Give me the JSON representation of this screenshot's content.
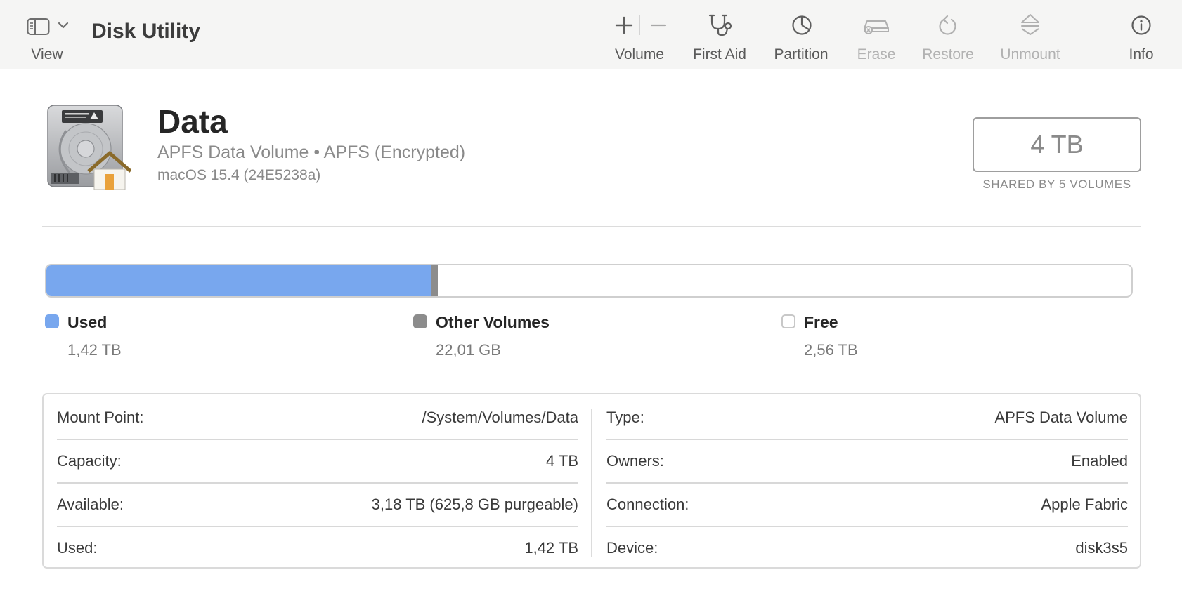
{
  "toolbar": {
    "view_label": "View",
    "app_title": "Disk Utility",
    "volume_label": "Volume",
    "first_aid_label": "First Aid",
    "partition_label": "Partition",
    "erase_label": "Erase",
    "restore_label": "Restore",
    "unmount_label": "Unmount",
    "info_label": "Info"
  },
  "volume": {
    "name": "Data",
    "type_line": "APFS Data Volume • APFS (Encrypted)",
    "os_line": "macOS 15.4 (24E5238a)",
    "capacity": "4 TB",
    "shared_label": "SHARED BY 5 VOLUMES"
  },
  "usage": {
    "used_fraction": 0.355,
    "other_fraction": 0.0055,
    "colors": {
      "used": "#78a7ee",
      "other": "#8c8c8c",
      "free": "#ffffff"
    },
    "legend": [
      {
        "name": "Used",
        "value": "1,42 TB"
      },
      {
        "name": "Other Volumes",
        "value": "22,01 GB"
      },
      {
        "name": "Free",
        "value": "2,56 TB"
      }
    ]
  },
  "info": {
    "left": [
      {
        "key": "Mount Point:",
        "value": "/System/Volumes/Data"
      },
      {
        "key": "Capacity:",
        "value": "4 TB"
      },
      {
        "key": "Available:",
        "value": "3,18 TB (625,8 GB purgeable)"
      },
      {
        "key": "Used:",
        "value": "1,42 TB"
      }
    ],
    "right": [
      {
        "key": "Type:",
        "value": "APFS Data Volume"
      },
      {
        "key": "Owners:",
        "value": "Enabled"
      },
      {
        "key": "Connection:",
        "value": "Apple Fabric"
      },
      {
        "key": "Device:",
        "value": "disk3s5"
      }
    ]
  },
  "icons": {
    "sidebar": "sidebar-icon",
    "chevron": "chevron-down-icon",
    "add": "plus-icon",
    "remove": "minus-icon",
    "first_aid": "stethoscope-icon",
    "partition": "pie-chart-icon",
    "erase": "erase-disk-icon",
    "restore": "restore-arrow-icon",
    "unmount": "eject-icon",
    "info": "info-icon",
    "volume": "hard-drive-home-icon"
  }
}
